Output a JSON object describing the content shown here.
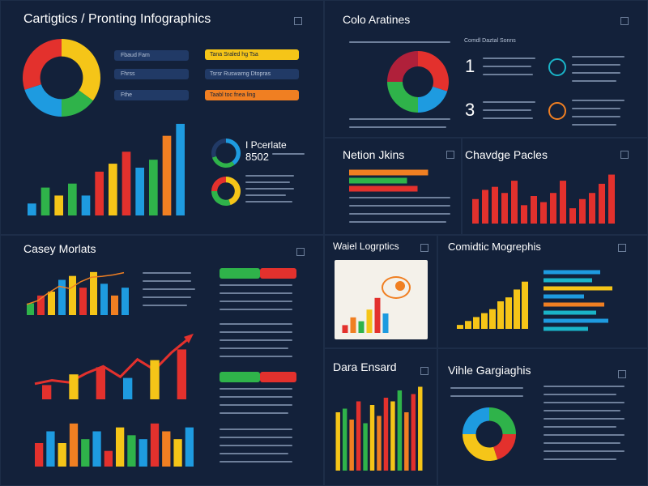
{
  "panels": {
    "top_left_title": "Cartigtics / Pronting Infographics",
    "top_right_title": "Colo Aratines",
    "nation_title": "Netion Jkins",
    "change_title": "Chavdge Pacles",
    "casey_title": "Casey Morlats",
    "wall_title": "Waiel Logrptics",
    "cornetic_title": "Comidtic Mogrephis",
    "data_title": "Dara Ensard",
    "visible_title": "Vihle Gargiaghis"
  },
  "top_left": {
    "stat_title": "I Pcerlate",
    "stat_value": "8502",
    "legend_labels": [
      "Fbaud Fam",
      "Fhrss",
      "Fthe"
    ],
    "legend_pills": [
      "Tana Sraled hg Tsa",
      "Tsrsr Ruswarng Dtopras",
      "Taabl toc fnea ling"
    ]
  },
  "top_right": {
    "numbers": [
      "1",
      "3"
    ],
    "subtitle": "Comdl Daztal Sonns"
  },
  "colors": {
    "blue": "#1e9be0",
    "green": "#2fb34a",
    "red": "#e3312d",
    "yellow": "#f5c518",
    "orange": "#f07f22",
    "teal": "#1ab4c8",
    "dark_blue": "#213a66",
    "background": "#0f1b2b",
    "panel": "#13213a"
  },
  "chart_data": [
    {
      "type": "pie",
      "name": "top_left_donut",
      "values": [
        35,
        15,
        20,
        30
      ],
      "colors": [
        "#f5c518",
        "#2fb34a",
        "#1e9be0",
        "#e3312d"
      ]
    },
    {
      "type": "bar",
      "name": "top_left_bars",
      "values": [
        15,
        35,
        25,
        40,
        25,
        55,
        65,
        80,
        60,
        70,
        100,
        115
      ],
      "colors": [
        "#1e9be0",
        "#2fb34a",
        "#f5c518",
        "#2fb34a",
        "#1e9be0",
        "#e3312d",
        "#f5c518",
        "#e3312d",
        "#1e9be0",
        "#2fb34a",
        "#f07f22",
        "#1e9be0"
      ],
      "ylim": [
        0,
        120
      ]
    },
    {
      "type": "pie",
      "name": "top_right_donut",
      "values": [
        30,
        20,
        25,
        25
      ],
      "colors": [
        "#e3312d",
        "#1e9be0",
        "#2fb34a",
        "#b0203a"
      ]
    },
    {
      "type": "bar",
      "name": "nation_hbars",
      "orientation": "horizontal",
      "values": [
        75,
        55,
        65
      ],
      "colors": [
        "#f07f22",
        "#2fb34a",
        "#e3312d"
      ],
      "xlim": [
        0,
        100
      ]
    },
    {
      "type": "bar",
      "name": "change_bars",
      "values": [
        40,
        55,
        60,
        50,
        70,
        30,
        45,
        35,
        50,
        70,
        25,
        40,
        50,
        65,
        80
      ],
      "colors": [
        "#e3312d"
      ],
      "ylim": [
        0,
        90
      ]
    },
    {
      "type": "line",
      "name": "casey_line",
      "x": [
        1,
        2,
        3,
        4,
        5,
        6,
        7,
        8,
        9,
        10
      ],
      "values": [
        20,
        28,
        45,
        60,
        55,
        70,
        80,
        82,
        85,
        90
      ],
      "colors": [
        "#f07f22"
      ],
      "ylim": [
        0,
        100
      ]
    },
    {
      "type": "bar",
      "name": "casey_bars",
      "values": [
        15,
        25,
        30,
        45,
        50,
        35,
        55,
        40,
        25,
        35
      ],
      "colors": [
        "#2fb34a",
        "#e3312d",
        "#f5c518",
        "#1e9be0",
        "#f5c518",
        "#e3312d",
        "#f5c518",
        "#1e9be0",
        "#f07f22",
        "#1e9be0"
      ],
      "ylim": [
        0,
        60
      ]
    },
    {
      "type": "line",
      "name": "casey_trend",
      "x": [
        1,
        2,
        3,
        4,
        5,
        6,
        7,
        8,
        9,
        10
      ],
      "values": [
        20,
        25,
        22,
        35,
        45,
        30,
        55,
        40,
        65,
        85
      ],
      "colors": [
        "#e3312d"
      ],
      "ylim": [
        0,
        100
      ]
    },
    {
      "type": "bar",
      "name": "casey_bottom_bars",
      "values": [
        30,
        45,
        30,
        55,
        35,
        45,
        20,
        50,
        40,
        35,
        55,
        45,
        35,
        50
      ],
      "colors": [
        "#e3312d",
        "#1e9be0",
        "#f5c518",
        "#f07f22",
        "#2fb34a",
        "#1e9be0",
        "#e3312d",
        "#f5c518",
        "#2fb34a",
        "#1e9be0",
        "#e3312d",
        "#f07f22",
        "#f5c518",
        "#1e9be0"
      ],
      "ylim": [
        0,
        60
      ]
    },
    {
      "type": "bar",
      "name": "wall_bars",
      "values": [
        10,
        20,
        15,
        30,
        45,
        25
      ],
      "colors": [
        "#e3312d",
        "#f07f22",
        "#2fb34a",
        "#f5c518",
        "#e3312d",
        "#1e9be0"
      ],
      "ylim": [
        0,
        50
      ]
    },
    {
      "type": "bar",
      "name": "cornetic_bars",
      "values": [
        5,
        10,
        15,
        20,
        25,
        35,
        40,
        50,
        60
      ],
      "colors": [
        "#f5c518"
      ],
      "ylim": [
        0,
        70
      ]
    },
    {
      "type": "bar",
      "name": "cornetic_hbars",
      "orientation": "horizontal",
      "values": [
        70,
        60,
        85,
        50,
        75,
        65,
        80,
        55
      ],
      "colors": [
        "#1e9be0",
        "#1ab4c8",
        "#f5c518",
        "#1e9be0",
        "#f07f22",
        "#1ab4c8",
        "#1e9be0",
        "#1ab4c8"
      ],
      "xlim": [
        0,
        100
      ]
    },
    {
      "type": "bar",
      "name": "data_bars",
      "values": [
        80,
        85,
        70,
        95,
        65,
        90,
        75,
        100,
        95,
        110,
        80,
        105,
        115
      ],
      "colors": [
        "#f5c518",
        "#2fb34a",
        "#f07f22",
        "#e3312d",
        "#2fb34a",
        "#f5c518",
        "#f07f22",
        "#e3312d",
        "#f5c518",
        "#2fb34a",
        "#f07f22",
        "#e3312d",
        "#f5c518"
      ],
      "ylim": [
        0,
        120
      ]
    },
    {
      "type": "pie",
      "name": "visible_donut",
      "values": [
        25,
        20,
        30,
        25
      ],
      "colors": [
        "#2fb34a",
        "#e3312d",
        "#f5c518",
        "#1e9be0"
      ]
    }
  ]
}
